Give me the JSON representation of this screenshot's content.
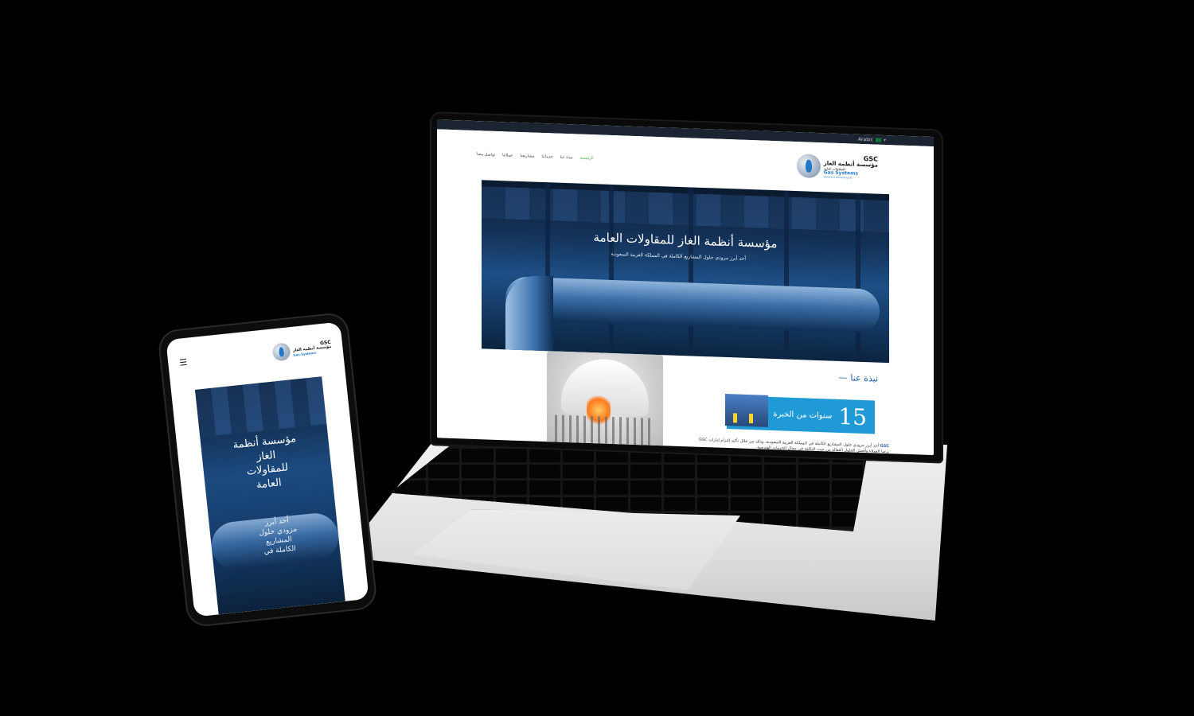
{
  "site": {
    "language_label": "Arabic",
    "nav": [
      "الرئيسية",
      "نبذة عنا",
      "خدماتنا",
      "مشاريعنا",
      "عملائنا",
      "تواصل معنا"
    ],
    "brand": {
      "short": "GSC",
      "name_ar": "مؤسسة أنظمة الغاز",
      "name_ar_sub": "للمقاولات العامة",
      "name_en": "Gas Systems",
      "name_en_sub": "General Contracting Est"
    },
    "hero": {
      "title": "مؤسسة أنظمة الغاز للمقاولات العامة",
      "subtitle": "أحد أبرز مزودي حلول المشاريع الكاملة في المملكة العربية السعودية"
    },
    "about": {
      "heading": "نبذة عنا",
      "years_number": "15",
      "years_label": "سنوات من الخبرة",
      "text_prefix": "GSC",
      "text": "أحد أبرز مزودي حلول المشاريع الكاملة في المملكة العربية السعودية، وذلك من خلال تأكيد إلتزام إدارات GSC برضا العملاء وأفضل الحلول الفعالة من حيث التكلفة في مجال الخدمات الهندسية"
    }
  },
  "phone": {
    "hero_title": "مؤسسة أنظمة الغاز للمقاولات العامة",
    "hero_subtitle": "أحد أبرز مزودي حلول المشاريع الكاملة في"
  },
  "colors": {
    "accent_blue": "#1f9ad6",
    "nav_active": "#4caf50",
    "brand_blue": "#1f78c8"
  }
}
